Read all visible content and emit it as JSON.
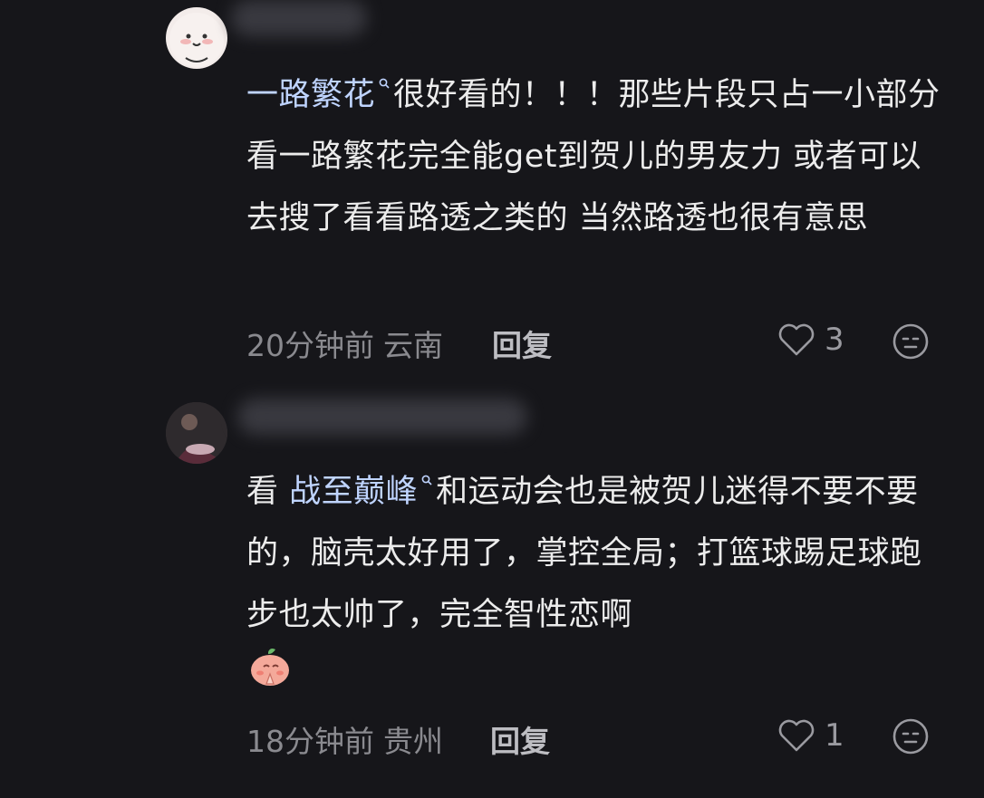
{
  "comments": [
    {
      "link_text": "一路繁花",
      "text_after_link": "很好看的！！！那些片段只占一小部分 看一路繁花完全能get到贺儿的男友力 或者可以去搜了看看路透之类的 当然路透也很有意思",
      "time": "20分钟前",
      "location": "云南",
      "reply_label": "回复",
      "likes": "3",
      "avatar_icon": "cartoon-face-avatar-icon",
      "dislike_icon": "neutral-face-icon"
    },
    {
      "prefix": "看 ",
      "link_text": "战至巅峰",
      "text_after_link": "和运动会也是被贺儿迷得不要不要的，脑壳太好用了，掌控全局；打篮球踢足球跑步也太帅了，完全智性恋啊",
      "emoji": "praying-peach-emoji",
      "time": "18分钟前",
      "location": "贵州",
      "reply_label": "回复",
      "likes": "1",
      "avatar_icon": "photo-avatar-icon",
      "dislike_icon": "neutral-face-icon"
    }
  ],
  "colors": {
    "background": "#16161a",
    "link": "#bfd4ff",
    "meta": "#8a8a8f"
  }
}
